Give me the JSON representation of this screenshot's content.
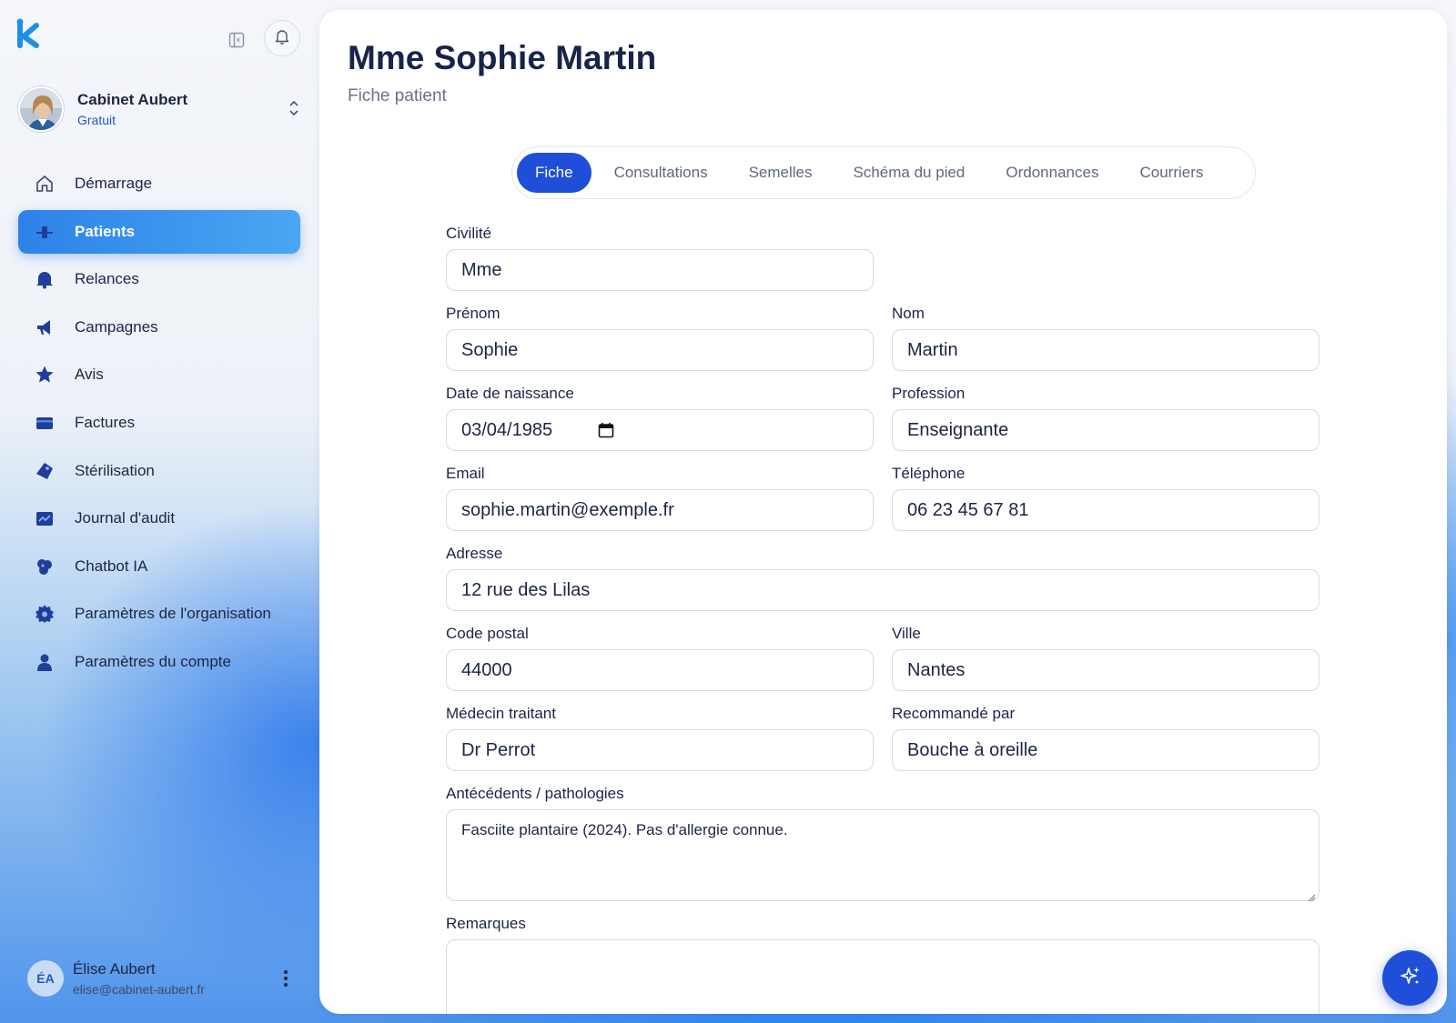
{
  "organization": {
    "name": "Cabinet Aubert",
    "plan": "Gratuit"
  },
  "nav": [
    {
      "key": "demarrage",
      "label": "Démarrage",
      "icon": "home-icon",
      "active": false
    },
    {
      "key": "patients",
      "label": "Patients",
      "icon": "users-icon",
      "active": true
    },
    {
      "key": "relances",
      "label": "Relances",
      "icon": "bell-filled-icon",
      "active": false
    },
    {
      "key": "campagnes",
      "label": "Campagnes",
      "icon": "megaphone-icon",
      "active": false
    },
    {
      "key": "avis",
      "label": "Avis",
      "icon": "star-icon",
      "active": false
    },
    {
      "key": "factures",
      "label": "Factures",
      "icon": "invoice-icon",
      "active": false
    },
    {
      "key": "sterilisation",
      "label": "Stérilisation",
      "icon": "tag-icon",
      "active": false
    },
    {
      "key": "journal",
      "label": "Journal d'audit",
      "icon": "journal-icon",
      "active": false
    },
    {
      "key": "chatbot",
      "label": "Chatbot IA",
      "icon": "chatbot-icon",
      "active": false
    },
    {
      "key": "org-settings",
      "label": "Paramètres de l'organisation",
      "icon": "gear-icon",
      "active": false
    },
    {
      "key": "account-settings",
      "label": "Paramètres du compte",
      "icon": "user-icon",
      "active": false
    }
  ],
  "user": {
    "initials": "ÉA",
    "name": "Élise Aubert",
    "email": "elise@cabinet-aubert.fr"
  },
  "page": {
    "title": "Mme Sophie Martin",
    "subtitle": "Fiche patient"
  },
  "tabs": [
    {
      "label": "Fiche",
      "active": true
    },
    {
      "label": "Consultations",
      "active": false
    },
    {
      "label": "Semelles",
      "active": false
    },
    {
      "label": "Schéma du pied",
      "active": false
    },
    {
      "label": "Ordonnances",
      "active": false
    },
    {
      "label": "Courriers",
      "active": false
    }
  ],
  "form": {
    "civilite": {
      "label": "Civilité",
      "value": "Mme"
    },
    "prenom": {
      "label": "Prénom",
      "value": "Sophie"
    },
    "nom": {
      "label": "Nom",
      "value": "Martin"
    },
    "naissance": {
      "label": "Date de naissance",
      "value": "03/04/1985"
    },
    "profession": {
      "label": "Profession",
      "value": "Enseignante"
    },
    "email": {
      "label": "Email",
      "value": "sophie.martin@exemple.fr"
    },
    "telephone": {
      "label": "Téléphone",
      "value": "06 23 45 67 81"
    },
    "adresse": {
      "label": "Adresse",
      "value": "12 rue des Lilas"
    },
    "code_postal": {
      "label": "Code postal",
      "value": "44000"
    },
    "ville": {
      "label": "Ville",
      "value": "Nantes"
    },
    "medecin": {
      "label": "Médecin traitant",
      "value": "Dr Perrot"
    },
    "recommande": {
      "label": "Recommandé par",
      "value": "Bouche à oreille"
    },
    "antecedents": {
      "label": "Antécédents / pathologies",
      "value": "Fasciite plantaire (2024). Pas d'allergie connue."
    },
    "remarques": {
      "label": "Remarques",
      "value": ""
    }
  },
  "colors": {
    "accent": "#1f4fd8",
    "nav_active": "#2c82e8",
    "text": "#1c2544"
  }
}
